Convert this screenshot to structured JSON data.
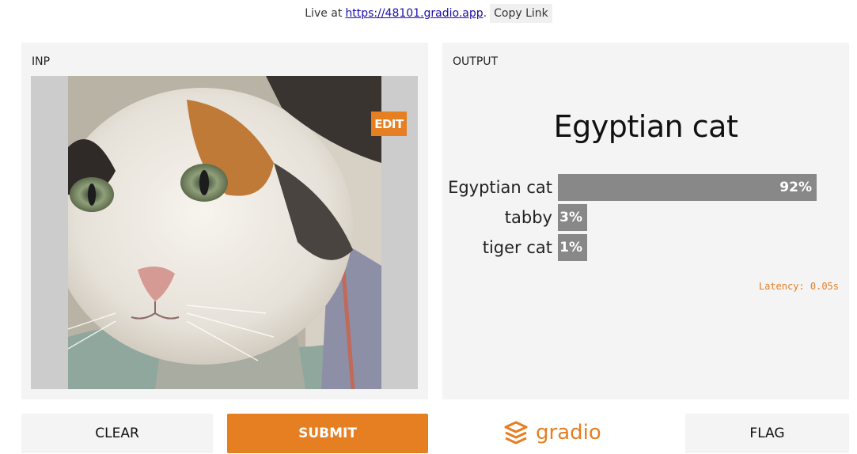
{
  "top_bar": {
    "live_prefix": "Live at",
    "url": "https://48101.gradio.app",
    "copy_label": "Copy Link"
  },
  "input_panel": {
    "label": "INP",
    "edit_label": "EDIT"
  },
  "output_panel": {
    "label": "OUTPUT",
    "result": "Egyptian cat",
    "confidences": [
      {
        "label": "Egyptian cat",
        "value": 0.92,
        "text": "92%"
      },
      {
        "label": "tabby",
        "value": 0.03,
        "text": "3%"
      },
      {
        "label": "tiger cat",
        "value": 0.01,
        "text": "1%"
      }
    ],
    "latency": "Latency: 0.05s"
  },
  "buttons": {
    "clear": "CLEAR",
    "submit": "SUBMIT",
    "flag": "FLAG"
  },
  "brand": {
    "name": "gradio",
    "icon": "gradio-logo-icon"
  },
  "colors": {
    "accent": "#e67e22",
    "panel_bg": "#f4f4f4",
    "bar": "#888888"
  }
}
